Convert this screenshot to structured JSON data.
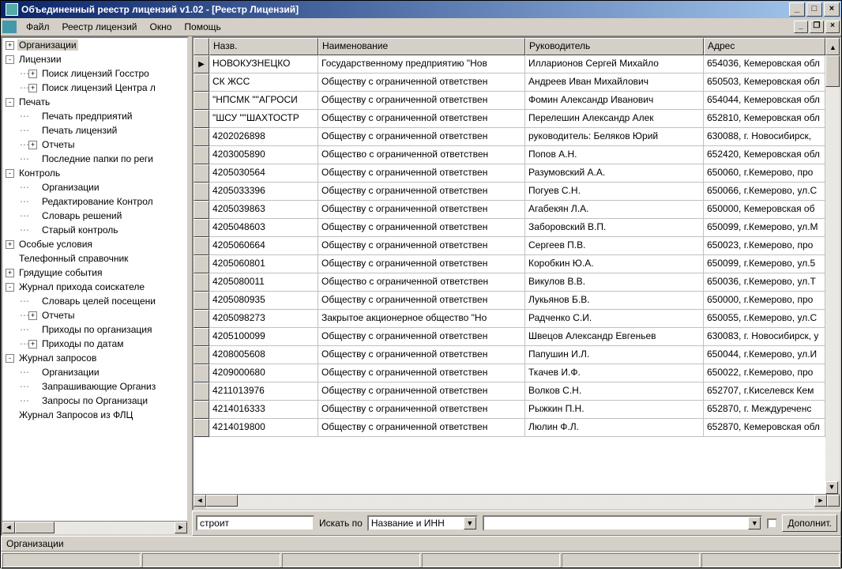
{
  "title": "Объединенный реестр лицензий v1.02 - [Реестр Лицензий]",
  "menu": {
    "file": "Файл",
    "registry": "Реестр лицензий",
    "window": "Окно",
    "help": "Помощь"
  },
  "tree": [
    {
      "d": 0,
      "exp": "+",
      "label": "Организации",
      "sel": true
    },
    {
      "d": 0,
      "exp": "-",
      "label": "Лицензии"
    },
    {
      "d": 1,
      "exp": "+",
      "label": "Поиск лицензий Госстро"
    },
    {
      "d": 1,
      "exp": "+",
      "label": "Поиск лицензий Центра л"
    },
    {
      "d": 0,
      "exp": "-",
      "label": "Печать"
    },
    {
      "d": 1,
      "exp": "",
      "label": "Печать предприятий"
    },
    {
      "d": 1,
      "exp": "",
      "label": "Печать лицензий"
    },
    {
      "d": 1,
      "exp": "+",
      "label": "Отчеты"
    },
    {
      "d": 1,
      "exp": "",
      "label": "Последние папки по реги"
    },
    {
      "d": 0,
      "exp": "-",
      "label": "Контроль"
    },
    {
      "d": 1,
      "exp": "",
      "label": "Организации"
    },
    {
      "d": 1,
      "exp": "",
      "label": "Редактирование Контрол"
    },
    {
      "d": 1,
      "exp": "",
      "label": "Словарь решений"
    },
    {
      "d": 1,
      "exp": "",
      "label": "Старый контроль"
    },
    {
      "d": 0,
      "exp": "+",
      "label": "Особые условия"
    },
    {
      "d": 0,
      "exp": "",
      "label": "Телефонный справочник"
    },
    {
      "d": 0,
      "exp": "+",
      "label": "Грядущие события"
    },
    {
      "d": 0,
      "exp": "-",
      "label": "Журнал прихода соискателе"
    },
    {
      "d": 1,
      "exp": "",
      "label": "Словарь целей посещени"
    },
    {
      "d": 1,
      "exp": "+",
      "label": "Отчеты"
    },
    {
      "d": 1,
      "exp": "",
      "label": "Приходы по организация"
    },
    {
      "d": 1,
      "exp": "+",
      "label": "Приходы по датам"
    },
    {
      "d": 0,
      "exp": "-",
      "label": "Журнал запросов"
    },
    {
      "d": 1,
      "exp": "",
      "label": "Организации"
    },
    {
      "d": 1,
      "exp": "",
      "label": "Запрашивающие Организ"
    },
    {
      "d": 1,
      "exp": "",
      "label": "Запросы по Организаци"
    },
    {
      "d": 0,
      "exp": "",
      "label": "Журнал Запросов из ФЛЦ"
    }
  ],
  "grid": {
    "headers": {
      "c0": "Назв.",
      "c1": "Наименование",
      "c2": "Руководитель",
      "c3": "Адрес"
    },
    "rows": [
      {
        "ind": "▶",
        "c0": " НОВОКУЗНЕЦКО",
        "c1": "Государственному предприятию \"Нов",
        "c2": "Илларионов Сергей Михайло",
        "c3": "654036, Кемеровская обл"
      },
      {
        "ind": "",
        "c0": " СК ЖСС",
        "c1": "Обществу с ограниченной ответствен",
        "c2": "Андреев Иван Михайлович",
        "c3": "650503, Кемеровская обл"
      },
      {
        "ind": "",
        "c0": "\"НПСМК \"\"АГРОСИ",
        "c1": "Обществу с ограниченной ответствен",
        "c2": "Фомин Александр Иванович",
        "c3": "654044, Кемеровская обл"
      },
      {
        "ind": "",
        "c0": "\"ШСУ \"\"ШАХТОСТР",
        "c1": "Обществу с ограниченной ответствен",
        "c2": "Перелешин Александр Алек",
        "c3": "652810, Кемеровская обл"
      },
      {
        "ind": "",
        "c0": "4202026898",
        "c1": "Обществу с ограниченной ответствен",
        "c2": "руководитель: Беляков Юрий",
        "c3": "630088, г. Новосибирск,"
      },
      {
        "ind": "",
        "c0": "4203005890",
        "c1": "Общество с ограниченной ответствен",
        "c2": "Попов А.Н.",
        "c3": "652420, Кемеровская обл"
      },
      {
        "ind": "",
        "c0": "4205030564",
        "c1": "Обществу с ограниченной ответствен",
        "c2": "Разумовский А.А.",
        "c3": " 650060, г.Кемерово, про"
      },
      {
        "ind": "",
        "c0": "4205033396",
        "c1": "Обществу с ограниченной ответствен",
        "c2": "Погуев С.Н.",
        "c3": " 650066, г.Кемерово, ул.С"
      },
      {
        "ind": "",
        "c0": "4205039863",
        "c1": "Обществу с ограниченной ответствен",
        "c2": "Агабекян Л.А.",
        "c3": " 650000, Кемеровская об"
      },
      {
        "ind": "",
        "c0": "4205048603",
        "c1": "Обществу с ограниченной ответствен",
        "c2": "Заборовский В.П.",
        "c3": " 650099, г.Кемерово, ул.М"
      },
      {
        "ind": "",
        "c0": "4205060664",
        "c1": "Обществу с ограниченной ответствен",
        "c2": "Сергеев П.В.",
        "c3": " 650023, г.Кемерово, про"
      },
      {
        "ind": "",
        "c0": "4205060801",
        "c1": "Обществу с ограниченной ответствен",
        "c2": "Коробкин Ю.А.",
        "c3": " 650099, г.Кемерово, ул.5"
      },
      {
        "ind": "",
        "c0": "4205080011",
        "c1": "Общество с ограниченной ответствен",
        "c2": "Викулов В.В.",
        "c3": " 650036, г.Кемерово, ул.Т"
      },
      {
        "ind": "",
        "c0": "4205080935",
        "c1": "Обществу с ограниченной ответствен",
        "c2": "Лукьянов Б.В.",
        "c3": " 650000, г.Кемерово, про"
      },
      {
        "ind": "",
        "c0": "4205098273",
        "c1": "Закрытое акционерное общество \"Но",
        "c2": "Радченко С.И.",
        "c3": " 650055, г.Кемерово, ул.С"
      },
      {
        "ind": "",
        "c0": "4205100099",
        "c1": "Обществу с ограниченной ответствен",
        "c2": "Швецов Александр Евгеньев",
        "c3": "630083, г. Новосибирск, у"
      },
      {
        "ind": "",
        "c0": "4208005608",
        "c1": "Обществу с ограниченной ответствен",
        "c2": "Папушин И.Л.",
        "c3": " 650044, г.Кемерово, ул.И"
      },
      {
        "ind": "",
        "c0": "4209000680",
        "c1": "Обществу с ограниченной ответствен",
        "c2": "Ткачев И.Ф.",
        "c3": " 650022, г.Кемерово, про"
      },
      {
        "ind": "",
        "c0": "4211013976",
        "c1": "Обществу с ограниченной ответствен",
        "c2": "Волков С.Н.",
        "c3": " 652707, г.Киселевск Кем"
      },
      {
        "ind": "",
        "c0": "4214016333",
        "c1": "Обществу с ограниченной ответствен",
        "c2": "Рыжкин П.Н.",
        "c3": " 652870, г. Междуреченс"
      },
      {
        "ind": "",
        "c0": "4214019800",
        "c1": "Обществу с ограниченной ответствен",
        "c2": "Люлин Ф.Л.",
        "c3": " 652870, Кемеровская обл"
      }
    ]
  },
  "search": {
    "value": "строит",
    "by_label": "Искать по",
    "by_value": "Название и ИНН",
    "extra_btn": "Дополнит."
  },
  "status_text": "Организации"
}
